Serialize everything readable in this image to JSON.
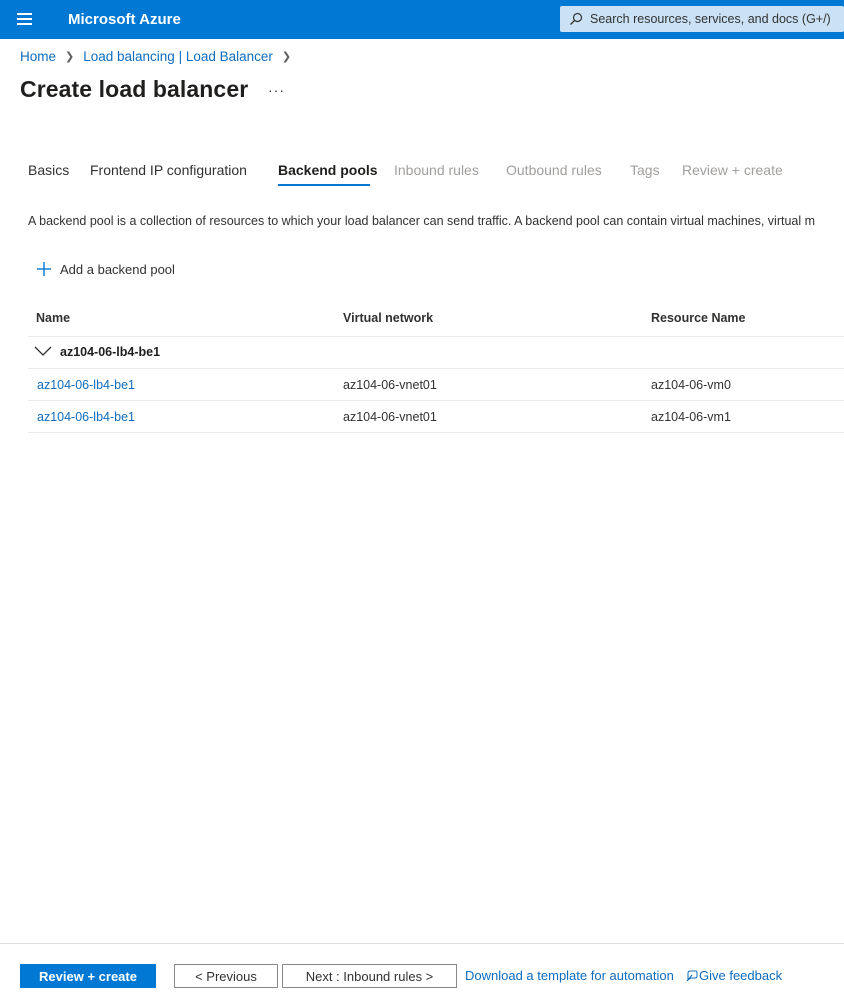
{
  "topbar": {
    "brand": "Microsoft Azure",
    "search_placeholder": "Search resources, services, and docs (G+/)",
    "accent_color": "#0078d4"
  },
  "breadcrumb": {
    "items": [
      "Home",
      "Load balancing | Load Balancer"
    ]
  },
  "page": {
    "title": "Create load balancer",
    "more_label": "···"
  },
  "tabs": [
    {
      "label": "Basics",
      "state": "enabled"
    },
    {
      "label": "Frontend IP configuration",
      "state": "enabled"
    },
    {
      "label": "Backend pools",
      "state": "active"
    },
    {
      "label": "Inbound rules",
      "state": "disabled"
    },
    {
      "label": "Outbound rules",
      "state": "disabled"
    },
    {
      "label": "Tags",
      "state": "disabled"
    },
    {
      "label": "Review + create",
      "state": "disabled"
    }
  ],
  "content": {
    "description": "A backend pool is a collection of resources to which your load balancer can send traffic. A backend pool can contain virtual machines, virtual m",
    "add_pool_label": "Add a backend pool"
  },
  "table": {
    "columns": [
      "Name",
      "Virtual network",
      "Resource Name"
    ],
    "group": {
      "label": "az104-06-lb4-be1",
      "icon": "chevron-down-icon"
    },
    "rows": [
      {
        "name": "az104-06-lb4-be1",
        "vnet": "az104-06-vnet01",
        "resource": "az104-06-vm0"
      },
      {
        "name": "az104-06-lb4-be1",
        "vnet": "az104-06-vnet01",
        "resource": "az104-06-vm1"
      }
    ]
  },
  "footer": {
    "review_create": "Review + create",
    "previous": "< Previous",
    "next": "Next : Inbound rules >",
    "download_template": "Download a template for automation",
    "give_feedback": "Give feedback"
  }
}
